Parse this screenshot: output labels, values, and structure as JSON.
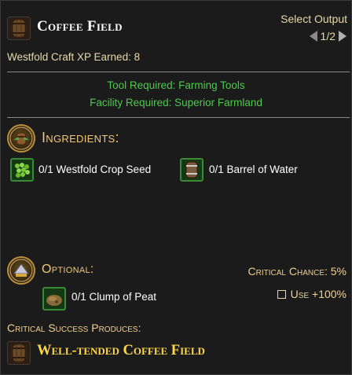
{
  "header": {
    "title": "Coffee Field",
    "select_output_label": "Select Output",
    "page_indicator": "1/2",
    "icon": "barrel-icon"
  },
  "xp": {
    "label": "Westfold Craft XP Earned: 8"
  },
  "requirements": {
    "tool": "Tool Required: Farming Tools",
    "facility": "Facility Required: Superior Farmland"
  },
  "ingredients": {
    "heading": "Ingredients:",
    "items": [
      {
        "text": "0/1 Westfold Crop Seed",
        "icon": "crop-seed-icon"
      },
      {
        "text": "0/1 Barrel of Water",
        "icon": "water-barrel-icon"
      }
    ]
  },
  "optional": {
    "heading": "Optional:",
    "critical_chance": "Critical Chance: 5%",
    "use_label": "Use +100%",
    "items": [
      {
        "text": "0/1 Clump of Peat",
        "icon": "peat-icon"
      }
    ]
  },
  "critical": {
    "label": "Critical Success Produces:",
    "result": "Well-tended Coffee Field",
    "icon": "barrel-icon"
  },
  "colors": {
    "requirement_green": "#4ec94e",
    "critical_gold": "#ffd84a",
    "section_gold": "#f0c878"
  }
}
